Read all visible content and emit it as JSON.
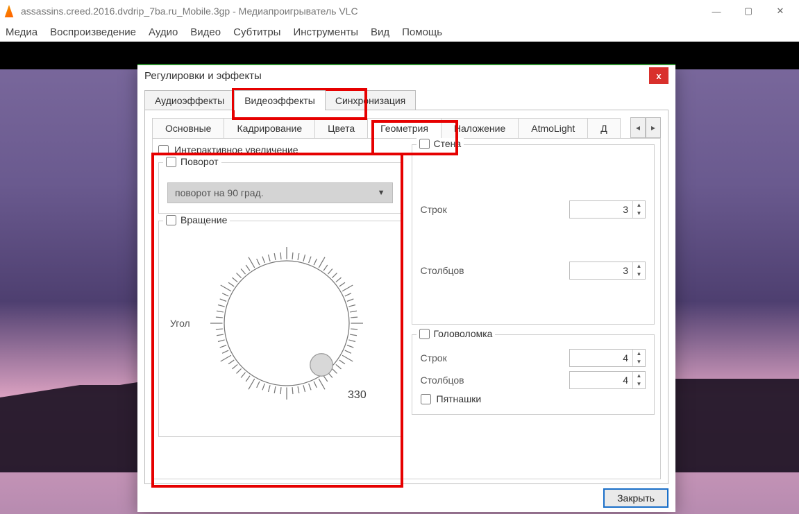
{
  "window": {
    "title": "assassins.creed.2016.dvdrip_7ba.ru_Mobile.3gp - Медиапроигрыватель VLC"
  },
  "menu": [
    "Медиа",
    "Воспроизведение",
    "Аудио",
    "Видео",
    "Субтитры",
    "Инструменты",
    "Вид",
    "Помощь"
  ],
  "dialog": {
    "title": "Регулировки и эффекты",
    "main_tabs": {
      "audio": "Аудиоэффекты",
      "video": "Видеоэффекты",
      "sync": "Синхронизация"
    },
    "sub_tabs": {
      "basic": "Основные",
      "crop": "Кадрирование",
      "colors": "Цвета",
      "geometry": "Геометрия",
      "overlay": "Наложение",
      "atmo": "AtmoLight",
      "more": "Д"
    },
    "geometry": {
      "interactive_zoom": "Интерактивное увеличение",
      "rotate_group": "Поворот",
      "rotate_select": "поворот на 90 град.",
      "rotation_group": "Вращение",
      "angle_label": "Угол",
      "angle_value": "330",
      "wall_group": "Стена",
      "wall_rows_label": "Строк",
      "wall_rows_value": "3",
      "wall_cols_label": "Столбцов",
      "wall_cols_value": "3",
      "puzzle_group": "Головоломка",
      "puzzle_rows_label": "Строк",
      "puzzle_rows_value": "4",
      "puzzle_cols_label": "Столбцов",
      "puzzle_cols_value": "4",
      "puzzle_shuffle": "Пятнашки"
    },
    "close_btn": "Закрыть"
  }
}
